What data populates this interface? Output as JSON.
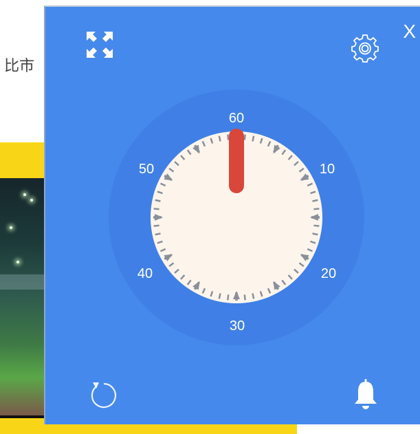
{
  "background": {
    "partial_text": "比市"
  },
  "timer": {
    "close_label": "X",
    "dial_labels": [
      "60",
      "10",
      "20",
      "30",
      "40",
      "50"
    ],
    "remaining_minutes": 0,
    "colors": {
      "panel": "#4589ec",
      "face": "#fdf5ec",
      "hand": "#d9463a",
      "ticks": "#8a8f99"
    }
  },
  "icons": {
    "fullscreen": "fullscreen-icon",
    "settings": "gear-icon",
    "reset": "reset-icon",
    "bell": "bell-icon"
  }
}
